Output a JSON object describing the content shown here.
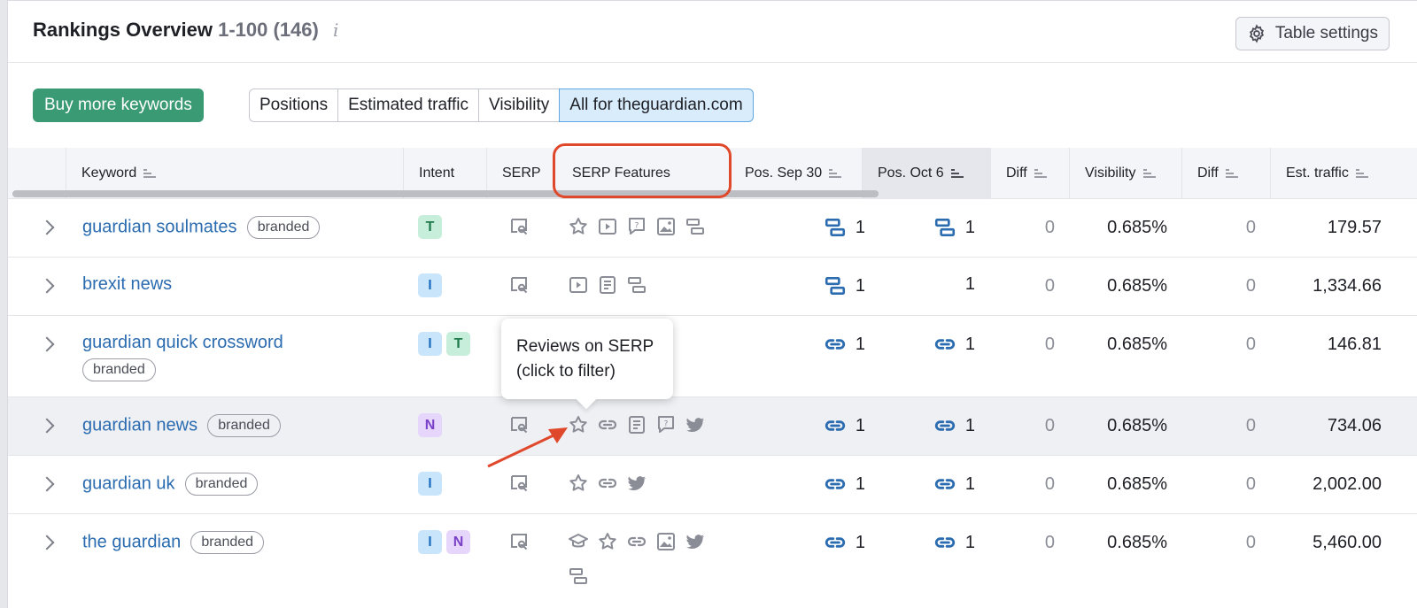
{
  "header": {
    "title": "Rankings Overview",
    "range": "1-100 (146)",
    "info_icon": "i",
    "table_settings_label": "Table settings"
  },
  "toolbar": {
    "buy_label": "Buy more keywords",
    "tabs": [
      {
        "label": "Positions",
        "active": false
      },
      {
        "label": "Estimated traffic",
        "active": false
      },
      {
        "label": "Visibility",
        "active": false
      },
      {
        "label": "All for theguardian.com",
        "active": true
      }
    ]
  },
  "columns": {
    "keyword": "Keyword",
    "intent": "Intent",
    "serp": "SERP",
    "serp_features": "SERP Features",
    "pos_sep": "Pos. Sep 30",
    "pos_oct": "Pos. Oct 6",
    "diff1": "Diff",
    "visibility": "Visibility",
    "diff2": "Diff",
    "traffic": "Est. traffic"
  },
  "tooltip": {
    "line1": "Reviews on SERP",
    "line2": "(click to filter)"
  },
  "colors": {
    "accent": "#2b6cb0",
    "highlight": "#e0482b",
    "buy": "#3a9a74"
  },
  "rows": [
    {
      "keyword": "guardian soulmates",
      "badge": "branded",
      "intents": [
        "T"
      ],
      "features": [
        "star-icon",
        "video-icon",
        "question-icon",
        "image-icon",
        "sitelinks-icon"
      ],
      "pos_sep": "1",
      "pos_sep_icon": "sitelinks-icon",
      "pos_oct": "1",
      "pos_oct_icon": "sitelinks-icon",
      "diff1": "0",
      "visibility": "0.685%",
      "diff2": "0",
      "traffic": "179.57"
    },
    {
      "keyword": "brexit news",
      "badge": "",
      "intents": [
        "I"
      ],
      "features": [
        "video-icon",
        "news-icon",
        "sitelinks-icon"
      ],
      "pos_sep": "1",
      "pos_sep_icon": "sitelinks-icon",
      "pos_oct": "1",
      "pos_oct_icon": "",
      "diff1": "0",
      "visibility": "0.685%",
      "diff2": "0",
      "traffic": "1,334.66"
    },
    {
      "keyword": "guardian quick crossword",
      "badge": "branded",
      "intents": [
        "I",
        "T"
      ],
      "features": [
        "sitelinks-icon"
      ],
      "pos_sep": "1",
      "pos_sep_icon": "link-icon",
      "pos_oct": "1",
      "pos_oct_icon": "link-icon",
      "diff1": "0",
      "visibility": "0.685%",
      "diff2": "0",
      "traffic": "146.81"
    },
    {
      "keyword": "guardian news",
      "badge": "branded",
      "intents": [
        "N"
      ],
      "features": [
        "star-icon",
        "link-icon",
        "news-icon",
        "question-icon",
        "twitter-icon"
      ],
      "pos_sep": "1",
      "pos_sep_icon": "link-icon",
      "pos_oct": "1",
      "pos_oct_icon": "link-icon",
      "diff1": "0",
      "visibility": "0.685%",
      "diff2": "0",
      "traffic": "734.06"
    },
    {
      "keyword": "guardian uk",
      "badge": "branded",
      "intents": [
        "I"
      ],
      "features": [
        "star-icon",
        "link-icon",
        "twitter-icon"
      ],
      "pos_sep": "1",
      "pos_sep_icon": "link-icon",
      "pos_oct": "1",
      "pos_oct_icon": "link-icon",
      "diff1": "0",
      "visibility": "0.685%",
      "diff2": "0",
      "traffic": "2,002.00"
    },
    {
      "keyword": "the guardian",
      "badge": "branded",
      "intents": [
        "I",
        "N"
      ],
      "features": [
        "knowledge-panel-icon",
        "star-icon",
        "link-icon",
        "image-icon",
        "twitter-icon",
        "sitelinks-icon"
      ],
      "pos_sep": "1",
      "pos_sep_icon": "link-icon",
      "pos_oct": "1",
      "pos_oct_icon": "link-icon",
      "diff1": "0",
      "visibility": "0.685%",
      "diff2": "0",
      "traffic": "5,460.00"
    }
  ]
}
